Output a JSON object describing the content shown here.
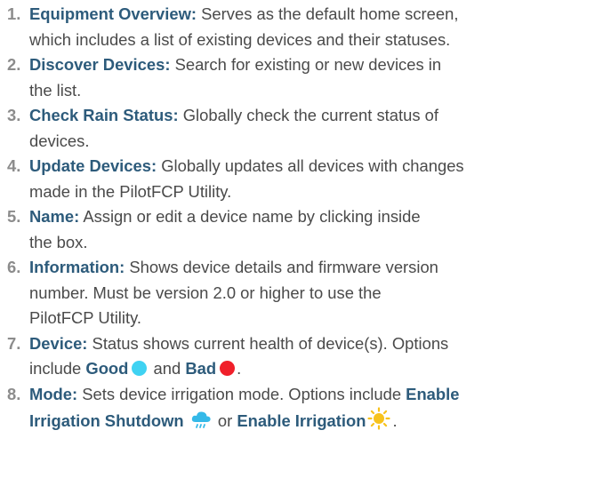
{
  "items": [
    {
      "num": "1.",
      "title": "Equipment Overview:",
      "line1": " Serves as the default home screen,",
      "line2": "which includes a list of existing devices and their statuses."
    },
    {
      "num": "2.",
      "title": "Discover Devices:",
      "line1": " Search for existing or new devices in",
      "line2": "the list."
    },
    {
      "num": "3.",
      "title": "Check Rain Status:",
      "line1": " Globally check the current status of",
      "line2": "devices."
    },
    {
      "num": "4.",
      "title": "Update Devices:",
      "line1": " Globally updates all devices with changes",
      "line2": "made in the PilotFCP Utility."
    },
    {
      "num": "5.",
      "title": "Name:",
      "line1": " Assign or edit a device name by clicking inside",
      "line2": "the box."
    },
    {
      "num": "6.",
      "title": "Information:",
      "line1": " Shows device details and firmware version",
      "line2": "number. Must be version 2.0 or higher to use the",
      "line3": "PilotFCP Utility."
    },
    {
      "num": "7.",
      "title": "Device:",
      "line1": " Status shows current health of device(s). Options",
      "line2_pre": "include ",
      "good": "Good",
      "and": " and ",
      "bad": "Bad",
      "end": "."
    },
    {
      "num": "8.",
      "title": "Mode:",
      "line1": " Sets device irrigation mode. Options include ",
      "enable_shutdown_1": "Enable",
      "enable_shutdown_2": "Irrigation Shutdown",
      "or": " or ",
      "enable_irrigation": "Enable Irrigation",
      "end": "."
    }
  ],
  "colors": {
    "title": "#2d5b7b",
    "number": "#8c8c8c",
    "good_dot": "#3fd2f2",
    "bad_dot": "#f01f2a",
    "cloud": "#34b9e8",
    "sun": "#f7c21c"
  },
  "icons": {
    "good": "cyan-dot-icon",
    "bad": "red-dot-icon",
    "shutdown": "rain-cloud-icon",
    "irrigation": "sun-icon"
  }
}
